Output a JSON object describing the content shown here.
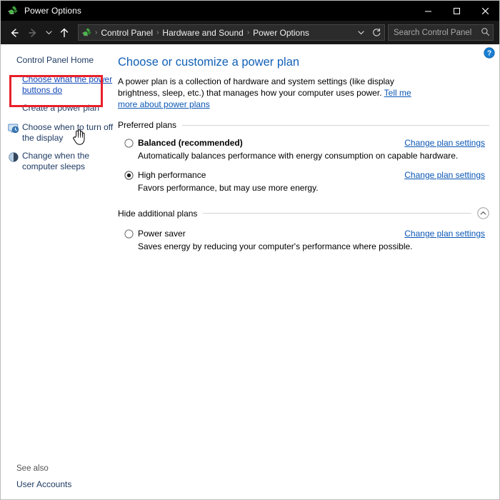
{
  "window": {
    "title": "Power Options",
    "app_icon": "power-plug-icon",
    "controls": {
      "minimize": "minimize-icon",
      "maximize": "maximize-icon",
      "close": "close-icon"
    }
  },
  "navbar": {
    "back": "back-arrow-icon",
    "forward": "forward-arrow-icon",
    "recent": "chevron-down-icon",
    "up": "up-arrow-icon",
    "breadcrumb": [
      "Control Panel",
      "Hardware and Sound",
      "Power Options"
    ],
    "separator": "›",
    "dropdown": "chevron-down-icon",
    "refresh": "refresh-icon",
    "search": {
      "placeholder": "Search Control Panel",
      "icon": "search-icon"
    }
  },
  "sidebar": {
    "home": "Control Panel Home",
    "items": [
      {
        "label": "Choose what the power buttons do",
        "icon": "none",
        "highlighted": true
      },
      {
        "label": "Create a power plan",
        "icon": "none",
        "highlighted": false
      },
      {
        "label": "Choose when to turn off the display",
        "icon": "display-clock-icon",
        "highlighted": false
      },
      {
        "label": "Change when the computer sleeps",
        "icon": "moon-sleep-icon",
        "highlighted": false
      }
    ],
    "see_also_label": "See also",
    "see_also_link": "User Accounts"
  },
  "content": {
    "help_icon": "help-question-icon",
    "title": "Choose or customize a power plan",
    "description_part1": "A power plan is a collection of hardware and system settings (like display brightness, sleep, etc.) that manages how your computer uses power. ",
    "description_link": "Tell me more about power plans",
    "preferred_section": "Preferred plans",
    "additional_section": "Hide additional plans",
    "collapse_icon": "chevron-up-circle-icon",
    "change_link": "Change plan settings",
    "preferred_plans": [
      {
        "name": "Balanced (recommended)",
        "selected": false,
        "bold": true,
        "description": "Automatically balances performance with energy consumption on capable hardware."
      },
      {
        "name": "High performance",
        "selected": true,
        "bold": false,
        "description": "Favors performance, but may use more energy."
      }
    ],
    "additional_plans": [
      {
        "name": "Power saver",
        "selected": false,
        "bold": false,
        "description": "Saves energy by reducing your computer's performance where possible."
      }
    ]
  },
  "annotation": {
    "highlight_color": "#e8202a",
    "cursor": "hand-pointer-cursor"
  },
  "colors": {
    "titlebar_bg": "#000000",
    "navbar_bg": "#191919",
    "link": "#0b57b5",
    "heading": "#1060b6",
    "sidebar_link": "#1f3b63"
  }
}
